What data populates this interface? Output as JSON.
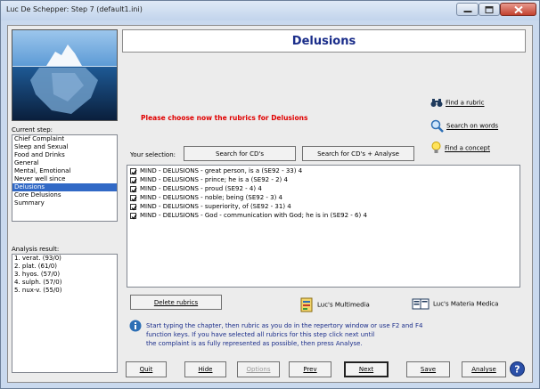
{
  "window": {
    "title": "Luc De Schepper: Step 7  (default1.ini)"
  },
  "left": {
    "current_step_label": "Current step:",
    "steps": [
      "Chief Complaint",
      "Sleep and Sexual",
      "Food and Drinks",
      "General",
      "Mental, Emotional",
      "Never well since",
      "Delusions",
      "Core Delusions",
      "Summary"
    ],
    "selected_step": "Delusions",
    "analysis_label": "Analysis result:",
    "analysis": [
      "1. verat. (93/0)",
      "2. plat. (61/0)",
      "3. hyos. (57/0)",
      "4. sulph. (57/0)",
      "5. nux-v. (55/0)"
    ]
  },
  "header": {
    "title": "Delusions"
  },
  "prompt": "Please choose now the rubrics for Delusions",
  "links": {
    "find_rubric": "Find a rubric",
    "search_words": "Search on words",
    "find_concept": "Find a concept"
  },
  "selection": {
    "label": "Your selection:",
    "search_cds": "Search for CD's",
    "search_cds_analyse": "Search for CD's + Analyse"
  },
  "rubrics": [
    "MIND - DELUSIONS - great person, is a (SE92 - 33) 4",
    "MIND - DELUSIONS - prince; he is a (SE92 - 2) 4",
    "MIND - DELUSIONS - proud (SE92 - 4) 4",
    "MIND - DELUSIONS - noble; being (SE92 - 3) 4",
    "MIND - DELUSIONS - superiority, of (SE92 - 31) 4",
    "MIND - DELUSIONS - God - communication with God; he is in (SE92 - 6) 4"
  ],
  "bottom": {
    "delete_rubrics": "Delete rubrics",
    "multimedia": "Luc's Multimedia",
    "materia_medica": "Luc's Materia Medica",
    "info_lines": [
      "Start typing the chapter, then rubric as you do in the repertory window or use F2 and F4",
      "function keys. If you have selected all rubrics for this step click next until",
      "the complaint is as fully represented as possible, then press Analyse."
    ]
  },
  "nav": {
    "quit": "Quit",
    "hide": "Hide",
    "options": "Options",
    "prev": "Prev",
    "next": "Next",
    "save": "Save",
    "analyse": "Analyse"
  },
  "colors": {
    "selection": "#3169c6",
    "title": "#1a2d8a",
    "prompt": "#e00000"
  }
}
